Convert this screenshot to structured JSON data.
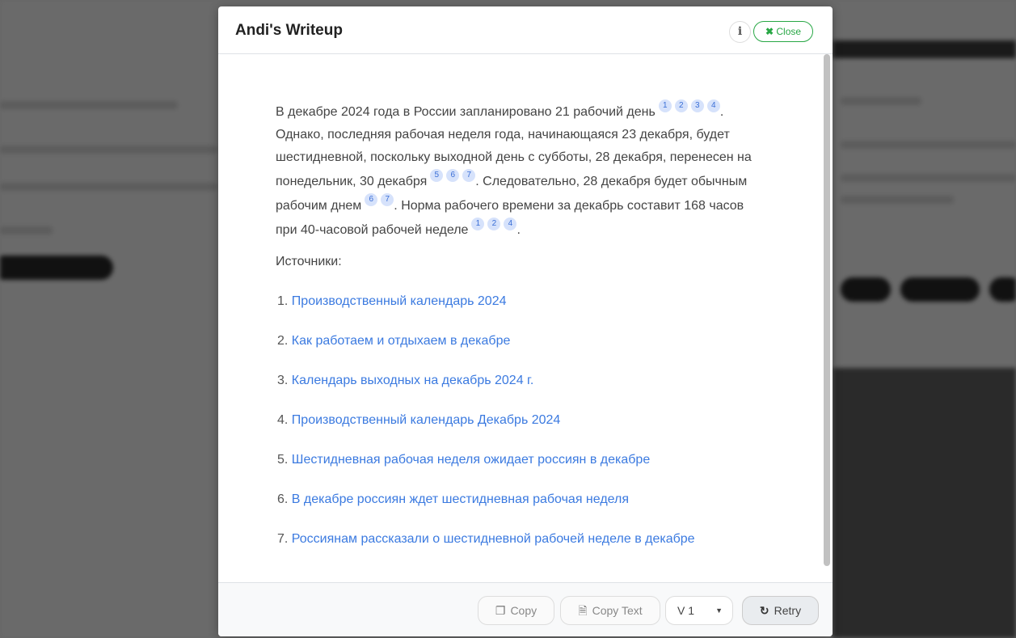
{
  "modal": {
    "title": "Andi's Writeup",
    "info_icon": "info-icon",
    "close_label": "Close",
    "close_icon": "x-icon",
    "accent": "#28a745"
  },
  "content": {
    "segments": [
      {
        "text": "В декабре 2024 года в России запланировано 21 рабочий день",
        "cites": [
          "1",
          "2",
          "3",
          "4"
        ]
      },
      {
        "text": ". Однако, последняя рабочая неделя года, начинающаяся 23 декабря, будет шестидневной, поскольку выходной день с субботы, 28 декабря, перенесен на понедельник, 30 декабря",
        "cites": [
          "5",
          "6",
          "7"
        ]
      },
      {
        "text": ". Следовательно, 28 декабря будет обычным рабочим днем",
        "cites": [
          "6",
          "7"
        ]
      },
      {
        "text": ". Норма рабочего времени за декабрь составит 168 часов при 40-часовой рабочей неделе",
        "cites": [
          "1",
          "2",
          "4"
        ]
      },
      {
        "text": ".",
        "cites": []
      }
    ],
    "sources_label": "Источники:",
    "sources": [
      "Производственный календарь 2024",
      "Как работаем и отдыхаем в декабре",
      "Календарь выходных на декабрь 2024 г.",
      "Производственный календарь Декабрь 2024",
      "Шестидневная рабочая неделя ожидает россиян в декабре",
      "В декабре россиян ждет шестидневная рабочая неделя",
      "Россиянам рассказали о шестидневной рабочей неделе в декабре"
    ]
  },
  "footer": {
    "copy": "Copy",
    "copy_text": "Copy Text",
    "version": "V 1",
    "retry": "Retry"
  }
}
